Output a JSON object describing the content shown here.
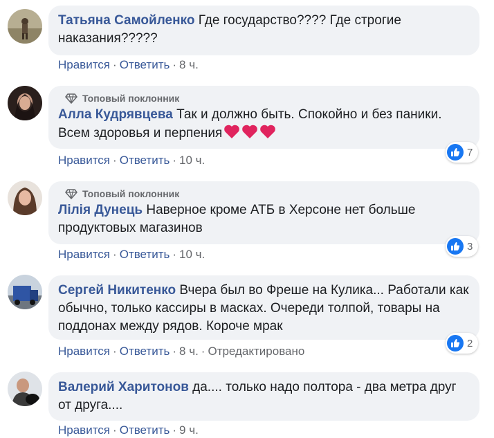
{
  "actions": {
    "like": "Нравится",
    "reply": "Ответить",
    "separator": "·"
  },
  "badge_label": "Топовый поклонник",
  "colors": {
    "author": "#385898",
    "bubble": "#f0f2f5",
    "like": "#1877f2",
    "heart": "#e0245e"
  },
  "comments": [
    {
      "author": "Татьяна Самойленко",
      "text": "Где государство???? Где строгие наказания?????",
      "time": "8 ч."
    },
    {
      "author": "Алла Кудрявцева",
      "text": "Так и должно быть. Спокойно и без паники. Всем здоровья и перпения",
      "hearts": "❤️❤️❤️",
      "time": "10 ч.",
      "likes": "7"
    },
    {
      "author": "Лілія Дунець",
      "text": "Наверное кроме АТБ в Херсоне нет больше продуктовых магазинов",
      "time": "10 ч.",
      "likes": "3"
    },
    {
      "author": "Сергей Никитенко",
      "text": "Вчера был во Фреше на Кулика... Работали как обычно, только кассиры в масках. Очереди толпой, товары на поддонах между рядов. Короче мрак",
      "time": "8 ч.",
      "edited": "Отредактировано",
      "likes": "2"
    },
    {
      "author": "Валерий Харитонов",
      "text": "да.... только надо полтора - два метра друг от друга....",
      "time": "9 ч."
    }
  ]
}
